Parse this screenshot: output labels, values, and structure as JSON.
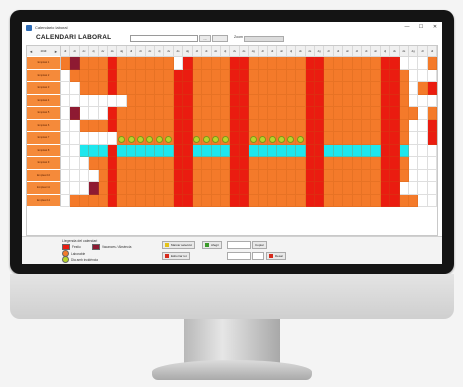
{
  "window": {
    "title": "Calendario laboral",
    "minimize_glyph": "—",
    "maximize_glyph": "☐",
    "close_glyph": "✕"
  },
  "toolbar": {
    "app_title": "CALENDARI LABORAL",
    "path_value": "",
    "browse_label": "...",
    "open_label": "",
    "zoom_label": "Zoom",
    "zoom_level": 1.0
  },
  "grid": {
    "year_value": "2019",
    "prev_glyph": "◄",
    "next_glyph": "►",
    "days": [
      "dl",
      "dt",
      "dc",
      "dj",
      "dv",
      "ds",
      "dg",
      "dl",
      "dt",
      "dc",
      "dj",
      "dv",
      "ds",
      "dg",
      "dl",
      "dt",
      "dc",
      "dj",
      "dv",
      "ds",
      "dg",
      "dl",
      "dt",
      "dc",
      "dj",
      "dv",
      "ds",
      "dg",
      "dl",
      "dt",
      "dc"
    ],
    "employees": [
      {
        "name": "Empleat 1",
        "cells": "oMooooooooooWoooooooooooooooooooooooWWWoo"
      },
      {
        "name": "Empleat 2",
        "cells": "WooooooooooooooooooooooooooooooooooooWWWo"
      },
      {
        "name": "Empleat 3",
        "cells": "WWoooooooooooooooooooooooooooooooooooWoRo"
      },
      {
        "name": "Empleat 4",
        "cells": "WWWWWWWoooooMooooooooooooooooooooooooWWWo"
      },
      {
        "name": "Empleat 5",
        "cells": "WMWWWoooooooooooooooooooooooooooooooooWoo"
      },
      {
        "name": "Empleat 6",
        "cells": "WWoooooooooooooooooooooooooooooooooooWWRo"
      },
      {
        "name": "Empleat 7",
        "cells": "WWWWWWGGGGGGGGGGGGGGGGGGGGGooooooooooWWRo"
      },
      {
        "name": "Empleat 8",
        "cells": "WWCCCCCCCCCCCCCCCCCCCCCCCCCCCCCCCCCCCWWWW"
      },
      {
        "name": "Empleat 9",
        "cells": "WWWoooooooooooooooooooooooMooooooooooWWWW"
      },
      {
        "name": "Empleat 10",
        "cells": "WWWWoooooooooooooooMoooooooooooooooooWWWW"
      },
      {
        "name": "Empleat 11",
        "cells": "WWWMooooooooooooooooooooooooooooooooWWWWW"
      },
      {
        "name": "Empleat 12",
        "cells": "WoooooooooooooooooMoooooooooooooooMMooWWW"
      }
    ],
    "red_columns": [
      5,
      12,
      13,
      18,
      19,
      26,
      27,
      34,
      35
    ]
  },
  "legend": {
    "title": "Llegenda del calendari",
    "items": [
      {
        "label": "Festiu",
        "color": "#ea1c10"
      },
      {
        "label": "Vacances / Absència",
        "color": "#8e1a32"
      },
      {
        "label": "Laborable",
        "color": "#f47a2a"
      },
      {
        "label": "Torn especial",
        "color": "#1ee7ee"
      },
      {
        "label": "Dia amb incidència",
        "color": "#b7d42a"
      }
    ]
  },
  "actions": {
    "btn1": "Marcar selecció",
    "btn2": "Afegir",
    "btn3": "Esborrar tot",
    "btn4": "Copiar",
    "btn5": "Desar"
  },
  "colors": {
    "laborable": "#f47a2a",
    "festiu": "#ea1c10",
    "absencia": "#8e1a32",
    "torn": "#1ee7ee",
    "incidencia": "#b7d42a"
  }
}
